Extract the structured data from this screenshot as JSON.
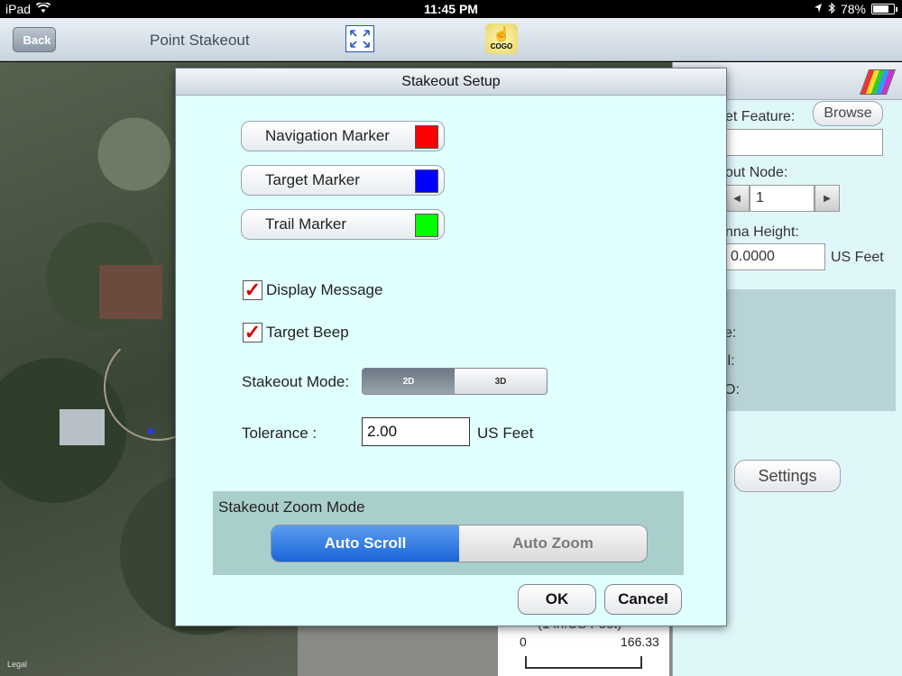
{
  "status_bar": {
    "device": "iPad",
    "time": "11:45 PM",
    "battery": "78%",
    "battery_level": 0.78
  },
  "nav_bar": {
    "back_label": "Back",
    "title": "Point Stakeout",
    "cogo_label": "COGO"
  },
  "map": {
    "legal": "Legal"
  },
  "right_panel": {
    "target_feature_label": "et Feature:",
    "browse_label": "Browse",
    "target_feature_value": "",
    "stakeout_node_label": "out Node:",
    "node_value": "1",
    "antenna_height_label": "nna Height:",
    "antenna_height_value": "0.0000",
    "antenna_unit": "US Feet",
    "info_rows": [
      "e:",
      "ll:",
      "O:"
    ],
    "settings_label": "Settings"
  },
  "scale_bar": {
    "unit": "(1 in:US Feet)",
    "start": "0",
    "end": "166.33"
  },
  "dialog": {
    "title": "Stakeout Setup",
    "markers": [
      {
        "label": "Navigation Marker",
        "color": "#ff0000"
      },
      {
        "label": "Target Marker",
        "color": "#0000ff"
      },
      {
        "label": "Trail Marker",
        "color": "#00ff00"
      }
    ],
    "display_message": {
      "label": "Display Message",
      "checked": true
    },
    "target_beep": {
      "label": "Target Beep",
      "checked": true
    },
    "stakeout_mode": {
      "label": "Stakeout Mode:",
      "options": [
        "2D",
        "3D"
      ],
      "selected": "2D"
    },
    "tolerance": {
      "label": "Tolerance :",
      "value": "2.00",
      "unit": "US Feet"
    },
    "zoom_mode": {
      "title": "Stakeout Zoom Mode",
      "options": [
        "Auto Scroll",
        "Auto Zoom"
      ],
      "selected": "Auto Scroll"
    },
    "ok_label": "OK",
    "cancel_label": "Cancel"
  }
}
